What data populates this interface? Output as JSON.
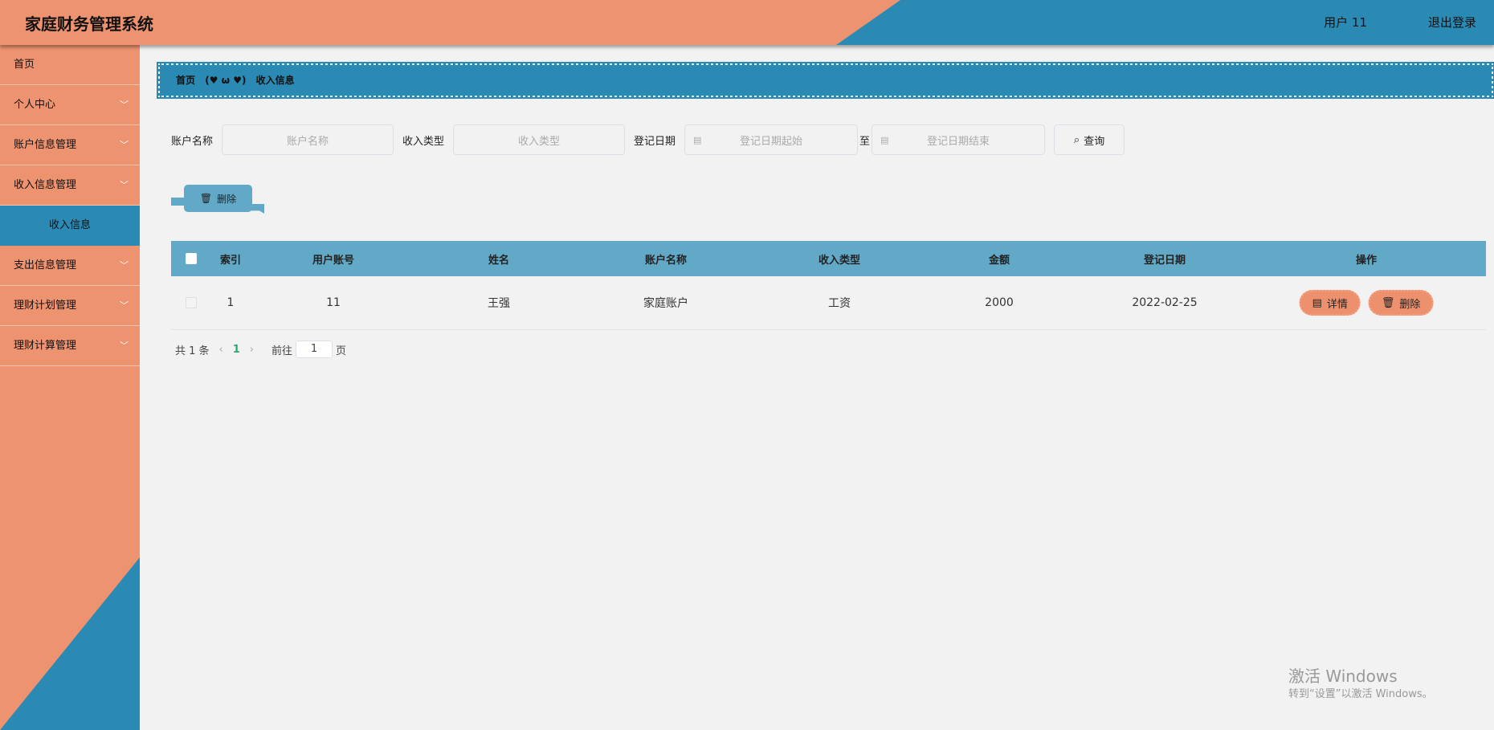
{
  "header": {
    "title": "家庭财务管理系统",
    "user": "用户 11",
    "logout": "退出登录"
  },
  "sidebar": {
    "items": [
      {
        "label": "首页",
        "expandable": false
      },
      {
        "label": "个人中心",
        "expandable": true
      },
      {
        "label": "账户信息管理",
        "expandable": true
      },
      {
        "label": "收入信息管理",
        "expandable": true
      },
      {
        "label": "收入信息",
        "sub": true,
        "active": true
      },
      {
        "label": "支出信息管理",
        "expandable": true
      },
      {
        "label": "理财计划管理",
        "expandable": true
      },
      {
        "label": "理财计算管理",
        "expandable": true
      }
    ]
  },
  "breadcrumb": {
    "home": "首页",
    "separator": "(♥ ω ♥)",
    "current": "收入信息"
  },
  "search": {
    "account_label": "账户名称",
    "account_placeholder": "账户名称",
    "type_label": "收入类型",
    "type_placeholder": "收入类型",
    "date_label": "登记日期",
    "date_start_placeholder": "登记日期起始",
    "to": "至",
    "date_end_placeholder": "登记日期结束",
    "query_button": "查询"
  },
  "toolbar": {
    "delete_button": "删除"
  },
  "table": {
    "columns": [
      "索引",
      "用户账号",
      "姓名",
      "账户名称",
      "收入类型",
      "金额",
      "登记日期",
      "操作"
    ],
    "rows": [
      {
        "index": "1",
        "user_account": "11",
        "name": "王强",
        "account_name": "家庭账户",
        "income_type": "工资",
        "amount": "2000",
        "date": "2022-02-25",
        "detail": "详情",
        "delete": "删除"
      }
    ]
  },
  "pagination": {
    "total": "共 1 条",
    "current_page": "1",
    "goto_label": "前往",
    "goto_value": "1",
    "page_suffix": "页"
  },
  "watermark": {
    "line1": "激活 Windows",
    "line2": "转到“设置”以激活 Windows。"
  },
  "colors": {
    "orange": "#ee9370",
    "blue": "#2b8ab4",
    "table_header": "#62a8c7"
  }
}
